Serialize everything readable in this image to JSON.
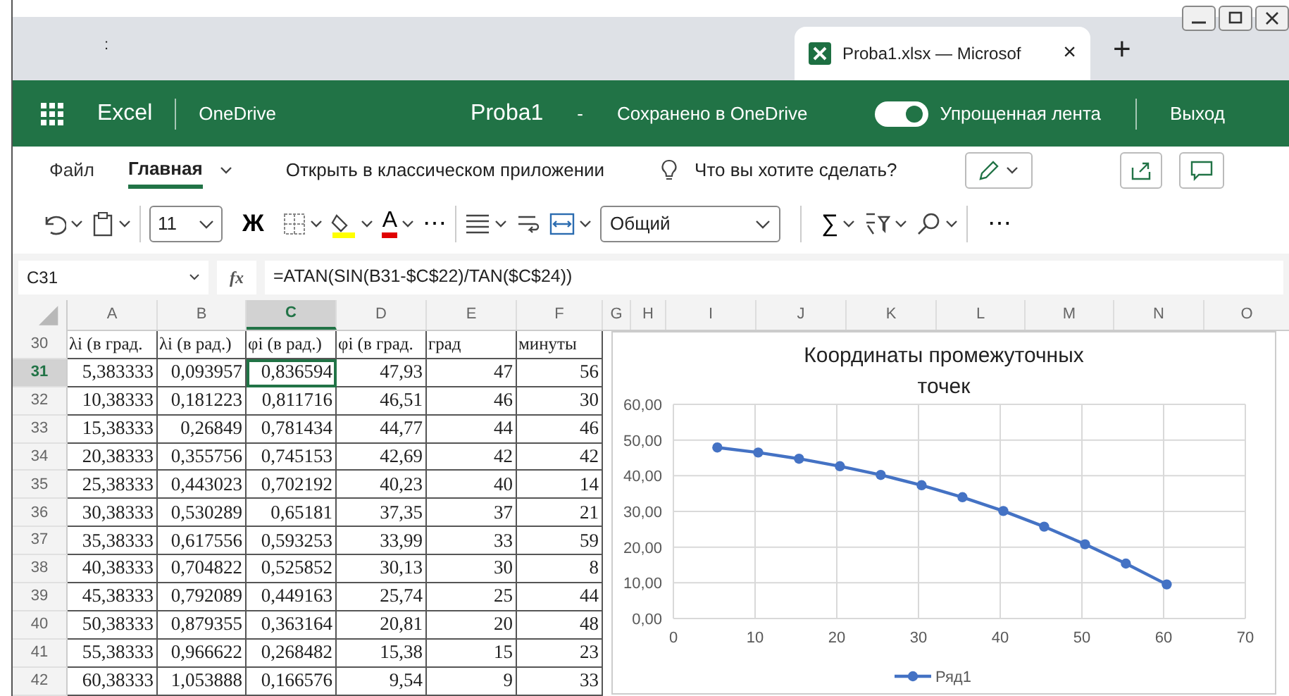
{
  "browser": {
    "menu_mark": ":",
    "tab_title": "Proba1.xlsx — Microsof",
    "tab_close": "×",
    "new_tab": "+"
  },
  "app_bar": {
    "app": "Excel",
    "onedrive": "OneDrive",
    "file": "Proba1",
    "separator": "-",
    "save_status": "Сохранено в OneDrive",
    "simplified_ribbon": {
      "label": "Упрощенная лента",
      "on": true
    },
    "exit": "Выход"
  },
  "ribbon_tabs": [
    {
      "label": "Файл",
      "selected": false
    },
    {
      "label": "Главная",
      "selected": true
    }
  ],
  "ribbon_links": {
    "open_desktop": "Открыть в классическом приложении",
    "tell_me": "Что вы хотите сделать?"
  },
  "toolbar": {
    "font_size": "11",
    "bold": "Ж",
    "font_color": "A",
    "more": "⋯",
    "number_format": "Общий",
    "sum": "∑",
    "more_2": "⋯"
  },
  "formula_bar": {
    "name_box": "C31",
    "fx": "fx",
    "formula": "=ATAN(SIN(B31-$C$22)/TAN($C$24))"
  },
  "sheet": {
    "columns": [
      {
        "label": "A",
        "selected": false
      },
      {
        "label": "B",
        "selected": false
      },
      {
        "label": "C",
        "selected": true
      },
      {
        "label": "D",
        "selected": false
      },
      {
        "label": "E",
        "selected": false
      },
      {
        "label": "F",
        "selected": false
      },
      {
        "label": "G",
        "selected": false
      },
      {
        "label": "H",
        "selected": false
      },
      {
        "label": "I",
        "selected": false
      },
      {
        "label": "J",
        "selected": false
      },
      {
        "label": "K",
        "selected": false
      },
      {
        "label": "L",
        "selected": false
      },
      {
        "label": "M",
        "selected": false
      },
      {
        "label": "N",
        "selected": false
      },
      {
        "label": "O",
        "selected": false
      }
    ],
    "rows": [
      {
        "number": "30",
        "selected": false,
        "kind": "header",
        "cells": [
          "λi (в град.",
          "λi (в рад.)",
          "φi (в рад.)",
          "φi (в град.",
          "град",
          "минуты"
        ]
      },
      {
        "number": "31",
        "selected": true,
        "kind": "data",
        "cells": [
          "5,383333",
          "0,093957",
          "0,836594",
          "47,93",
          "47",
          "56"
        ]
      },
      {
        "number": "32",
        "selected": false,
        "kind": "data",
        "cells": [
          "10,38333",
          "0,181223",
          "0,811716",
          "46,51",
          "46",
          "30"
        ]
      },
      {
        "number": "33",
        "selected": false,
        "kind": "data",
        "cells": [
          "15,38333",
          "0,26849",
          "0,781434",
          "44,77",
          "44",
          "46"
        ]
      },
      {
        "number": "34",
        "selected": false,
        "kind": "data",
        "cells": [
          "20,38333",
          "0,355756",
          "0,745153",
          "42,69",
          "42",
          "42"
        ]
      },
      {
        "number": "35",
        "selected": false,
        "kind": "data",
        "cells": [
          "25,38333",
          "0,443023",
          "0,702192",
          "40,23",
          "40",
          "14"
        ]
      },
      {
        "number": "36",
        "selected": false,
        "kind": "data",
        "cells": [
          "30,38333",
          "0,530289",
          "0,65181",
          "37,35",
          "37",
          "21"
        ]
      },
      {
        "number": "37",
        "selected": false,
        "kind": "data",
        "cells": [
          "35,38333",
          "0,617556",
          "0,593253",
          "33,99",
          "33",
          "59"
        ]
      },
      {
        "number": "38",
        "selected": false,
        "kind": "data",
        "cells": [
          "40,38333",
          "0,704822",
          "0,525852",
          "30,13",
          "30",
          "8"
        ]
      },
      {
        "number": "39",
        "selected": false,
        "kind": "data",
        "cells": [
          "45,38333",
          "0,792089",
          "0,449163",
          "25,74",
          "25",
          "44"
        ]
      },
      {
        "number": "40",
        "selected": false,
        "kind": "data",
        "cells": [
          "50,38333",
          "0,879355",
          "0,363164",
          "20,81",
          "20",
          "48"
        ]
      },
      {
        "number": "41",
        "selected": false,
        "kind": "data",
        "cells": [
          "55,38333",
          "0,966622",
          "0,268482",
          "15,38",
          "15",
          "23"
        ]
      },
      {
        "number": "42",
        "selected": false,
        "kind": "data",
        "cells": [
          "60,38333",
          "1,053888",
          "0,166576",
          "9,54",
          "9",
          "33"
        ]
      }
    ]
  },
  "chart_data": {
    "type": "line",
    "title": "Координаты промежуточных точек",
    "x": [
      5.383333,
      10.38333,
      15.38333,
      20.38333,
      25.38333,
      30.38333,
      35.38333,
      40.38333,
      45.38333,
      50.38333,
      55.38333,
      60.38333
    ],
    "series": [
      {
        "name": "Ряд1",
        "color": "#4472c4",
        "values": [
          47.93,
          46.51,
          44.77,
          42.69,
          40.23,
          37.35,
          33.99,
          30.13,
          25.74,
          20.81,
          15.38,
          9.54
        ]
      }
    ],
    "grid": true,
    "marker": true,
    "xlim": [
      0,
      70
    ],
    "ylim": [
      0,
      60
    ],
    "xticks": [
      0,
      10,
      20,
      30,
      40,
      50,
      60,
      70
    ],
    "yticks": [
      {
        "value": 0,
        "label": "0,00"
      },
      {
        "value": 10,
        "label": "10,00"
      },
      {
        "value": 20,
        "label": "20,00"
      },
      {
        "value": 30,
        "label": "30,00"
      },
      {
        "value": 40,
        "label": "40,00"
      },
      {
        "value": 50,
        "label": "50,00"
      },
      {
        "value": 60,
        "label": "60,00"
      }
    ]
  }
}
